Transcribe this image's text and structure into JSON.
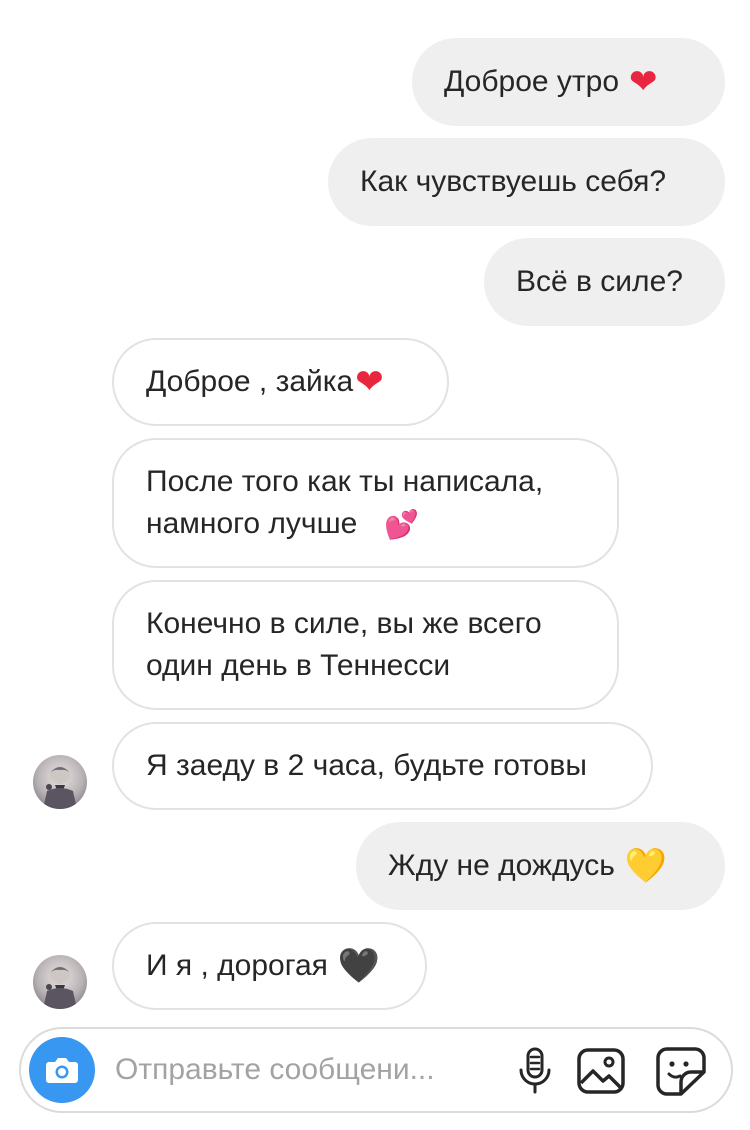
{
  "messages": [
    {
      "dir": "out",
      "text": "Доброе утро",
      "emoji": "❤",
      "emoji_class": "heart-red",
      "emoji_name": "red-heart-emoji"
    },
    {
      "dir": "out",
      "text": "Как чувствуешь себя?"
    },
    {
      "dir": "out",
      "text": "Всё в силе?"
    },
    {
      "dir": "in",
      "text": "Доброе , зайка",
      "emoji": "❤",
      "emoji_class": "heart-red",
      "emoji_name": "red-heart-emoji"
    },
    {
      "dir": "in",
      "text": "После того как ты написала,\nнамного лучше",
      "emoji": "💕",
      "emoji_class": "hearts-pink",
      "emoji_name": "two-hearts-emoji"
    },
    {
      "dir": "in",
      "text": "Конечно в силе, вы же всего\nодин день в Теннесси"
    },
    {
      "dir": "in",
      "text": "Я заеду в 2 часа, будьте готовы",
      "avatar": true
    },
    {
      "dir": "out",
      "text": "Жду не дождусь",
      "emoji": "💛",
      "emoji_class": "heart-yellow",
      "emoji_name": "yellow-heart-emoji"
    },
    {
      "dir": "in",
      "text": "И я , дорогая",
      "emoji": "🖤",
      "emoji_class": "heart-black",
      "emoji_name": "black-heart-emoji",
      "avatar": true
    }
  ],
  "composer": {
    "placeholder": "Отправьте сообщени...",
    "camera_icon": "camera-icon",
    "mic_icon": "microphone-icon",
    "gallery_icon": "gallery-icon",
    "sticker_icon": "sticker-icon"
  },
  "colors": {
    "outgoing_bubble": "#efefef",
    "incoming_border": "#e2e2e2",
    "accent": "#3897f0",
    "text": "#262626",
    "placeholder": "#a3a3a3"
  }
}
